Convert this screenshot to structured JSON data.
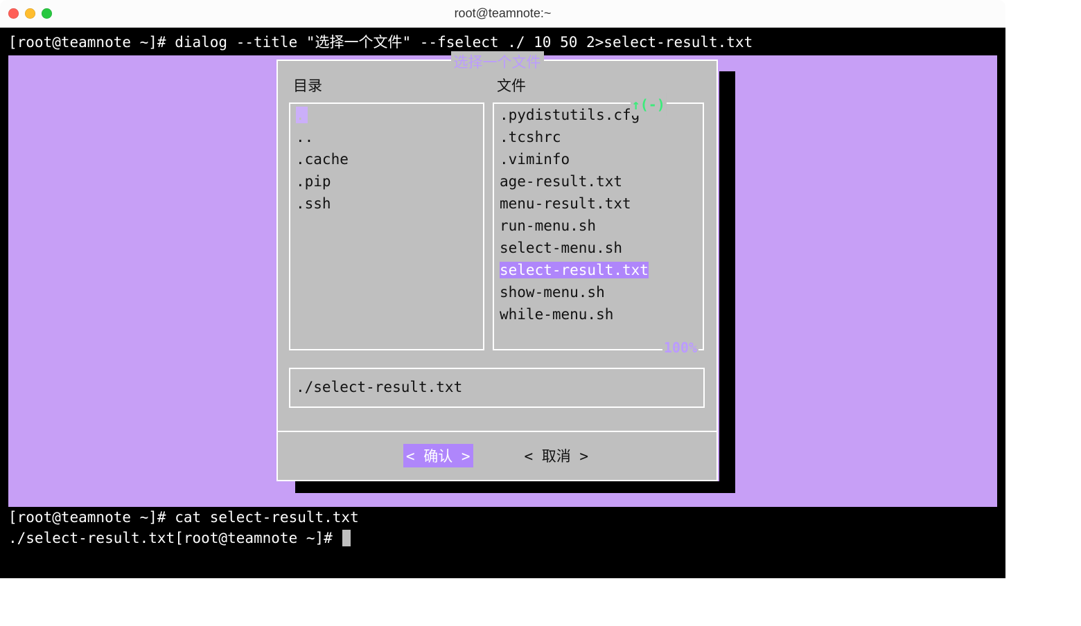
{
  "window": {
    "title": "root@teamnote:~"
  },
  "terminal": {
    "prompt1": "[root@teamnote ~]# ",
    "command1": "dialog --title \"选择一个文件\" --fselect ./ 10 50 2>select-result.txt",
    "prompt2": "[root@teamnote ~]# ",
    "command2": "cat select-result.txt",
    "output2_prefix": "./select-result.txt",
    "prompt3": "[root@teamnote ~]# "
  },
  "dialog": {
    "title": "选择一个文件",
    "dir_label": "目录",
    "file_label": "文件",
    "indicator": "↑(-)",
    "percent": "100%",
    "directories": [
      ".",
      "..",
      ".cache",
      ".pip",
      ".ssh"
    ],
    "files": [
      ".pydistutils.cfg",
      ".tcshrc",
      ".viminfo",
      "age-result.txt",
      "menu-result.txt",
      "run-menu.sh",
      "select-menu.sh",
      "select-result.txt",
      "show-menu.sh",
      "while-menu.sh"
    ],
    "selected_file_index": 7,
    "path_value": "./select-result.txt",
    "ok_label": "< 确认 >",
    "cancel_label": "< 取消 >"
  }
}
